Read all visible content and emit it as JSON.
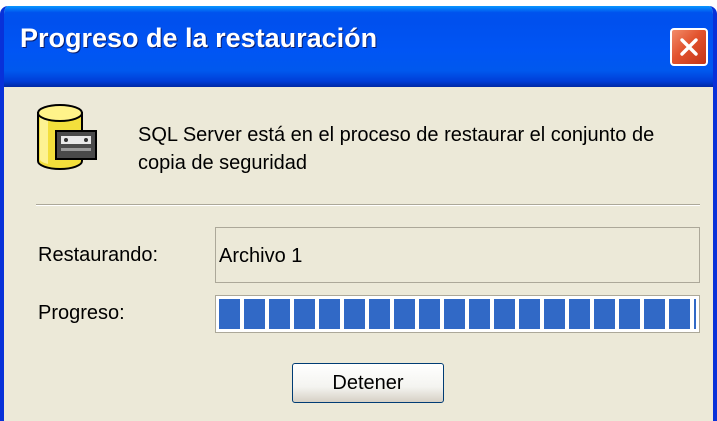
{
  "window": {
    "title": "Progreso de la restauración",
    "close_icon": "close-icon"
  },
  "dialog": {
    "icon": "database-tape-icon",
    "message": "SQL Server está en el proceso de restaurar el conjunto de copia de seguridad",
    "restoring_label": "Restaurando:",
    "restoring_value": "Archivo 1",
    "progress_label": "Progreso:",
    "progress_fraction": 1.0,
    "stop_button": "Detener"
  },
  "colors": {
    "titlebar": "#0055f4",
    "close_button": "#e2532e",
    "progress_fill": "#3169c6",
    "dialog_background": "#ece9d8"
  }
}
